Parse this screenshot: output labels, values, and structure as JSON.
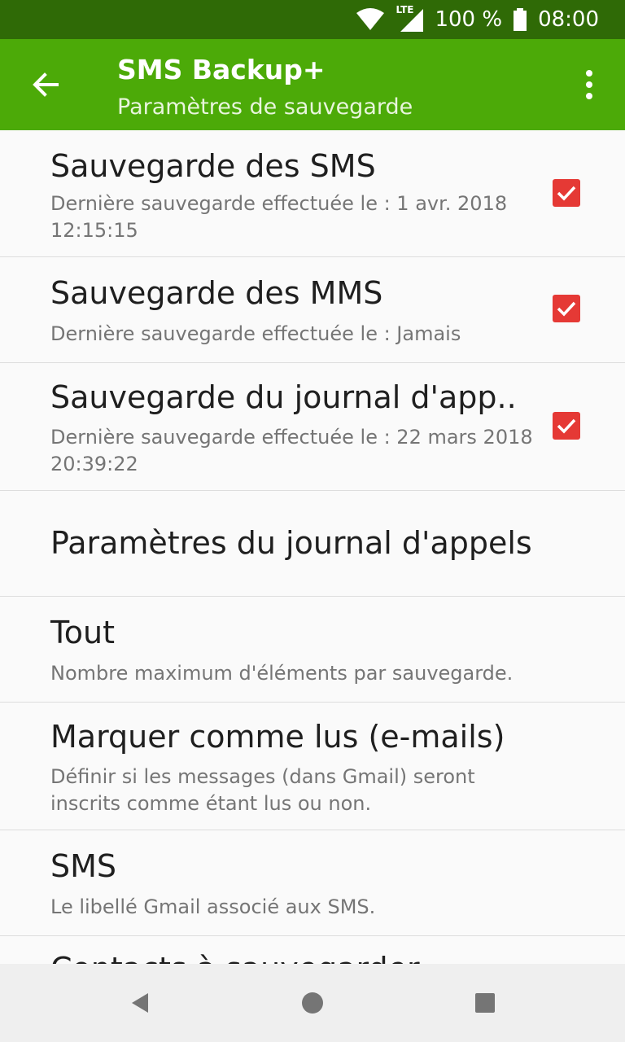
{
  "status": {
    "battery": "100 %",
    "time": "08:00",
    "network": "LTE"
  },
  "appbar": {
    "title": "SMS Backup+",
    "subtitle": "Paramètres de sauvegarde"
  },
  "items": [
    {
      "title": "Sauvegarde des SMS",
      "summary": "Dernière sauvegarde effectuée le : 1 avr. 2018 12:15:15",
      "checked": true
    },
    {
      "title": "Sauvegarde des MMS",
      "summary": "Dernière sauvegarde effectuée le : Jamais",
      "checked": true
    },
    {
      "title": "Sauvegarde du journal d'app..",
      "summary": "Dernière sauvegarde effectuée le : 22 mars 2018 20:39:22",
      "checked": true
    },
    {
      "title": "Paramètres du journal d'appels",
      "summary": ""
    },
    {
      "title": "Tout",
      "summary": "Nombre maximum d'éléments par sauvegarde."
    },
    {
      "title": "Marquer comme lus (e-mails)",
      "summary": "Définir si les messages (dans Gmail) seront inscrits comme étant lus ou non."
    },
    {
      "title": "SMS",
      "summary": "Le libellé Gmail associé aux SMS."
    },
    {
      "title": "Contacts à sauvegarder",
      "summary": ""
    }
  ],
  "colors": {
    "statusbar": "#2f6a06",
    "appbar": "#4caa08",
    "checkbox": "#e53935"
  },
  "icons": {
    "back": "arrow-back-icon",
    "menu": "more-vert-icon",
    "nav": [
      "back-triangle-icon",
      "home-circle-icon",
      "recents-square-icon"
    ]
  }
}
